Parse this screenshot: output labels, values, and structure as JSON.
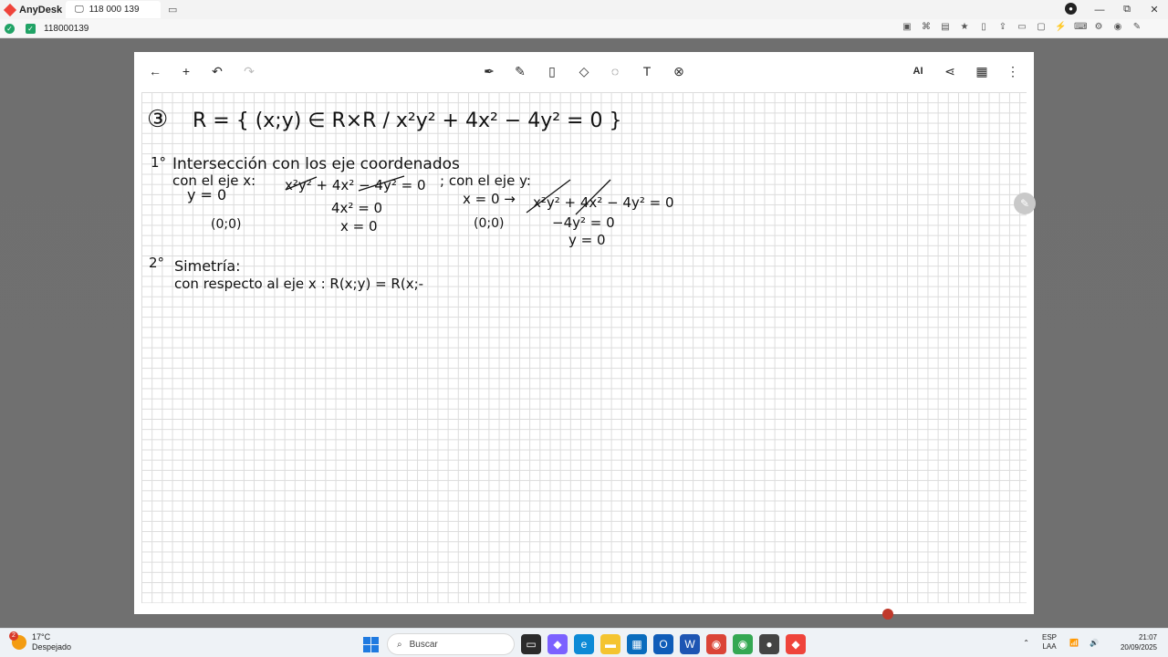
{
  "anydesk": {
    "app_name": "AnyDesk",
    "tab_label": "118 000 139",
    "address_id": "118000139",
    "user_initial": "●"
  },
  "window_controls": {
    "minimize": "—",
    "restore": "⧉",
    "close": "✕"
  },
  "note_toolbar": {
    "left": [
      "back-icon",
      "add-icon",
      "undo-icon",
      "redo-icon"
    ],
    "center": [
      "pen-icon",
      "marker-icon",
      "highlighter-icon",
      "eraser-icon",
      "lasso-icon",
      "text-icon",
      "close-circle-icon"
    ],
    "right": [
      "ai-icon",
      "share-icon",
      "grid-icon",
      "more-icon"
    ]
  },
  "handwriting": {
    "line1_num": "③",
    "line1": "R = { (x;y) ∈ R×R / x²y² + 4x² − 4y² = 0 }",
    "step1_num": "1°",
    "step1_title": "Intersección con los eje coordenados",
    "x_axis_label": "con el eje x:",
    "x_eq": "x²y² + 4x² − 4y² = 0",
    "y_axis_label": "; con el eje y:",
    "y_zero": "y = 0",
    "x_res1": "4x² = 0",
    "x_res2": "x = 0",
    "x_point": "(0;0)",
    "y_sub": "x = 0 →",
    "y_eq": "x²y² + 4x² − 4y² = 0",
    "y_res1": "−4y² = 0",
    "y_res2": "y = 0",
    "y_point": "(0;0)",
    "step2_num": "2°",
    "step2_title": "Simetría:",
    "step2_line": "con respecto al eje x :  R(x;y) = R(x;-"
  },
  "taskbar": {
    "weather_temp": "17°C",
    "weather_desc": "Despejado",
    "weather_badge": "2",
    "search_placeholder": "Buscar",
    "lang_top": "ESP",
    "lang_bottom": "LAA",
    "time": "21:07",
    "date": "20/09/2025"
  },
  "colors": {
    "anydesk_red": "#ef443b",
    "ok_green": "#21a366",
    "ink": "#111111"
  }
}
